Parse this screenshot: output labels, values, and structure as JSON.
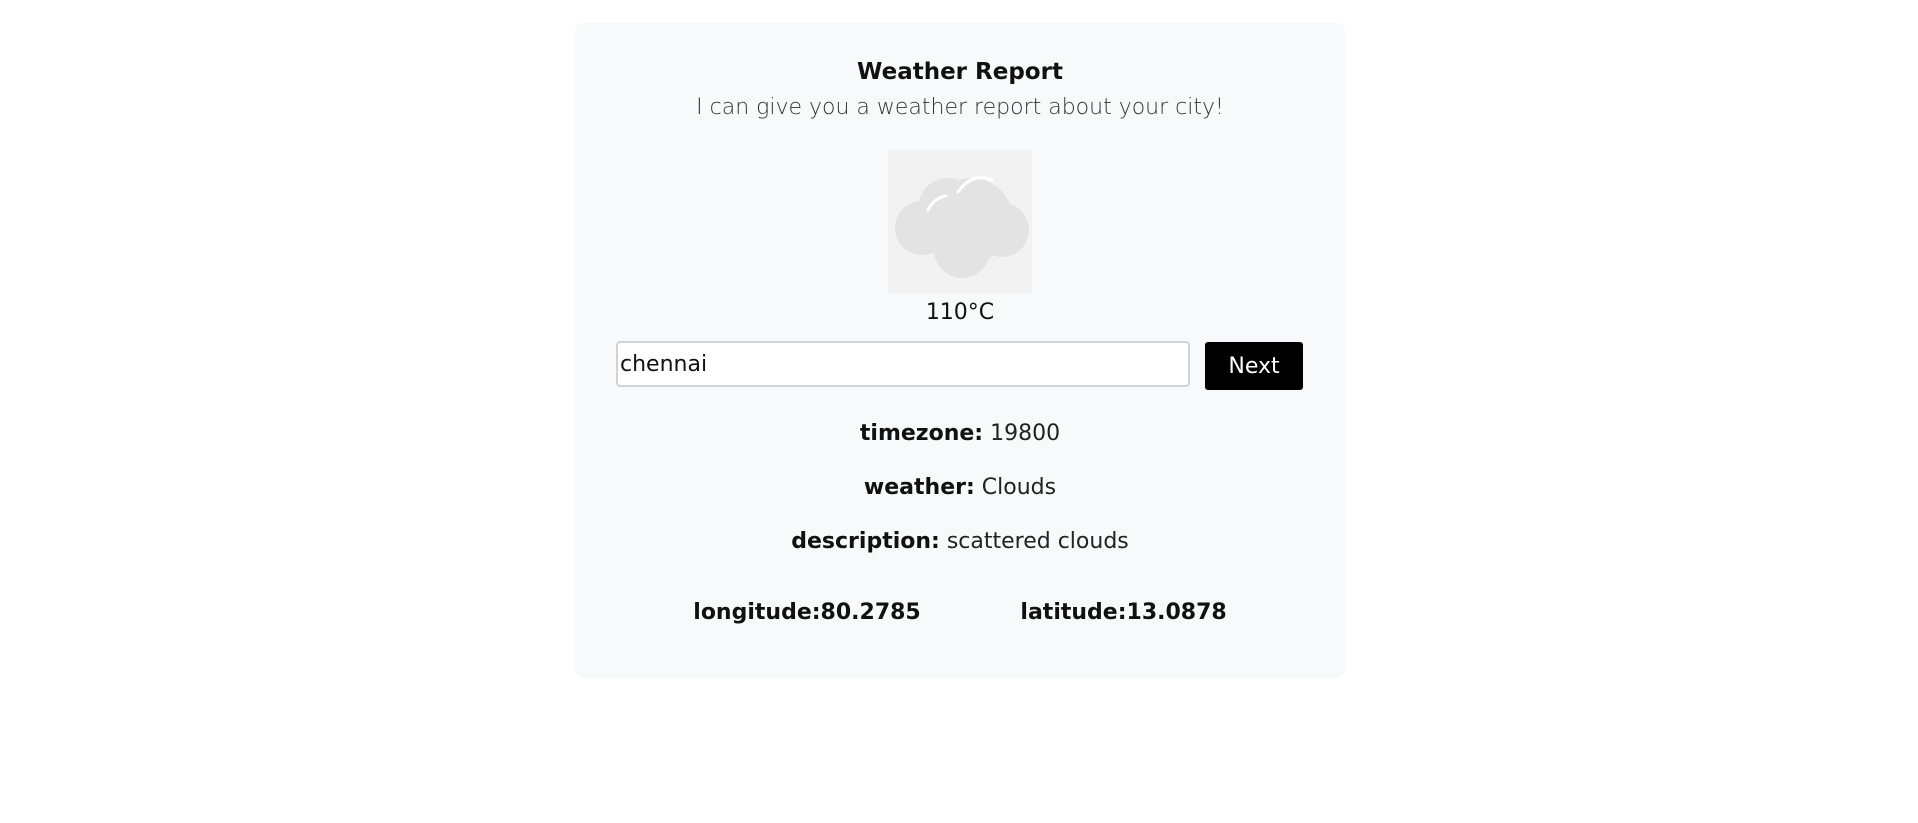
{
  "header": {
    "title": "Weather Report",
    "subtitle": "I can give you a weather report about your city!"
  },
  "weather_icon": {
    "icon": "cloud-icon",
    "color": "#e3e3e3"
  },
  "temperature": "110°C",
  "search": {
    "value": "chennai",
    "button_label": "Next"
  },
  "details": {
    "timezone_label": "timezone:",
    "timezone_value": "19800",
    "weather_label": "weather:",
    "weather_value": "Clouds",
    "description_label": "description:",
    "description_value": "scattered clouds"
  },
  "coordinates": {
    "longitude": "longitude:80.2785",
    "latitude": "latitude:13.0878"
  }
}
